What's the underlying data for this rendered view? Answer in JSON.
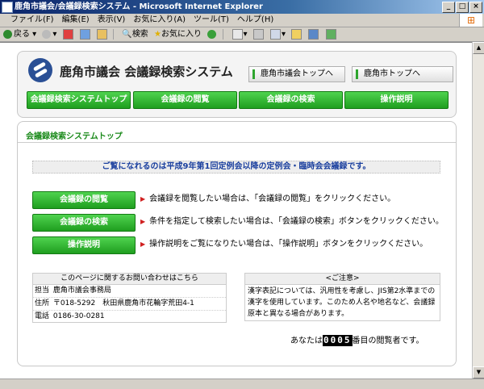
{
  "window": {
    "title": "鹿角市議会/会議録検索システム - Microsoft Internet Explorer",
    "controls": [
      "_",
      "□",
      "×"
    ]
  },
  "menu": [
    "ファイル(F)",
    "編集(E)",
    "表示(V)",
    "お気に入り(A)",
    "ツール(T)",
    "ヘルプ(H)"
  ],
  "toolbar": {
    "back_label": "戻る",
    "search_label": "検索",
    "favorites_label": "お気に入り"
  },
  "header": {
    "site_title": "鹿角市議会 会議録検索システム",
    "top_links": [
      "鹿角市議会トップへ",
      "鹿角市トップへ"
    ],
    "nav": [
      "会議録検索システムトップ",
      "会議録の閲覧",
      "会議録の検索",
      "操作説明"
    ]
  },
  "content": {
    "section_title": "会議録検索システムトップ",
    "notice": "ご覧になれるのは平成9年第1回定例会以降の定例会・臨時会会議録です。",
    "actions": [
      {
        "label": "会議録の閲覧",
        "desc": "会議録を閲覧したい場合は、「会議録の閲覧」をクリックください。"
      },
      {
        "label": "会議録の検索",
        "desc": "条件を指定して検索したい場合は、「会議録の検索」ボタンをクリックください。"
      },
      {
        "label": "操作説明",
        "desc": "操作説明をご覧になりたい場合は、「操作説明」ボタンをクリックください。"
      }
    ],
    "contact": {
      "heading": "このページに関するお問い合わせはこちら",
      "rows": [
        {
          "key": "担当",
          "value": "鹿角市議会事務局"
        },
        {
          "key": "住所",
          "value": "〒018-5292　秋田県鹿角市花輪字荒田4-1"
        },
        {
          "key": "電話",
          "value": "0186-30-0281"
        }
      ]
    },
    "note": {
      "heading": "<ご注意>",
      "body": "漢字表記については、汎用性を考慮し、JIS第2水準までの漢字を使用しています。このため人名や地名など、会議録原本と異なる場合があります。"
    },
    "counter": {
      "prefix": "あなたは",
      "digits": "0005",
      "suffix": "番目の閲覧者です。"
    }
  }
}
